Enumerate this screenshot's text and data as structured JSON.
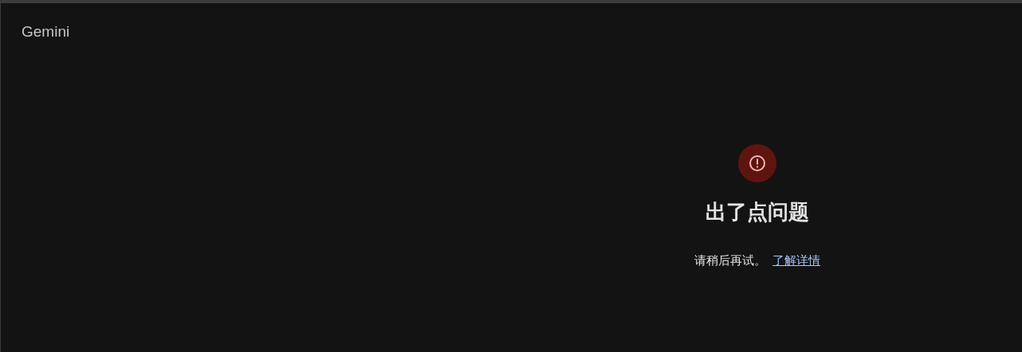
{
  "app": {
    "title": "Gemini"
  },
  "error": {
    "heading": "出了点问题",
    "message": "请稍后再试。",
    "link": "了解详情"
  }
}
